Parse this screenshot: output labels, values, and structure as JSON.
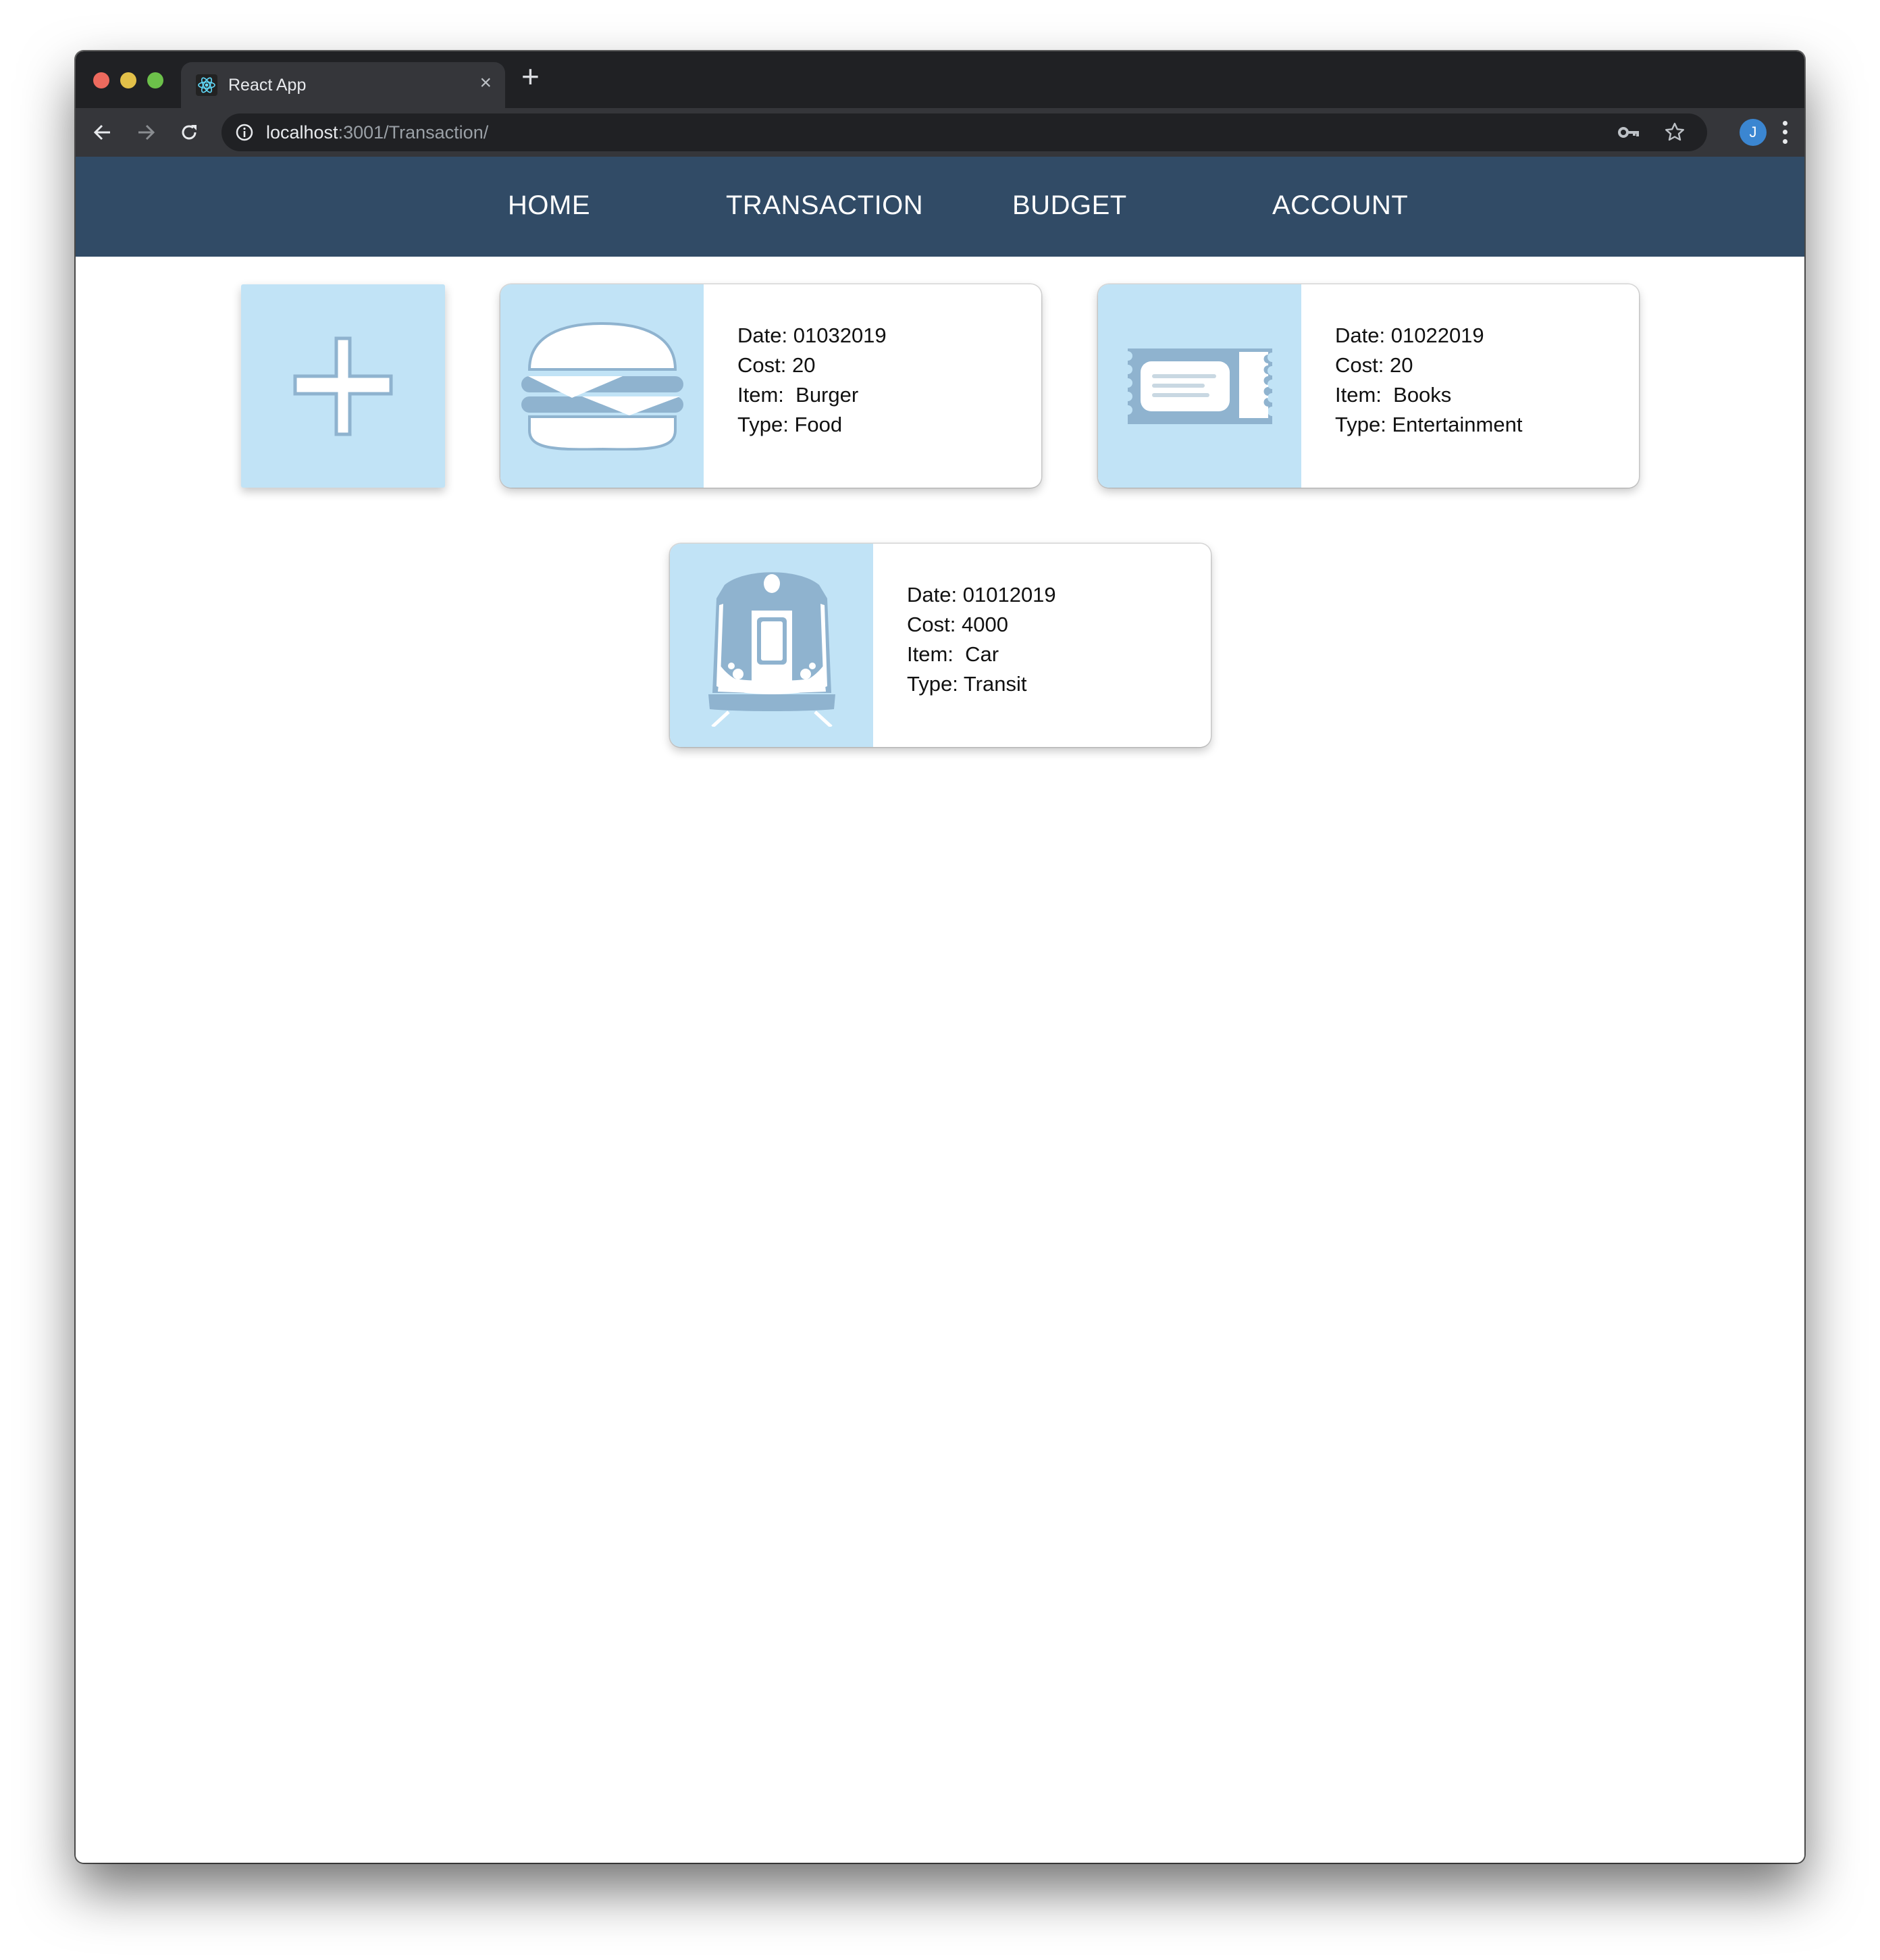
{
  "browser": {
    "tab_title": "React App",
    "new_tab_label": "+",
    "close_tab_label": "×",
    "url_host": "localhost",
    "url_rest": ":3001/Transaction/",
    "avatar_initial": "J"
  },
  "nav": {
    "items": [
      {
        "label": "HOME"
      },
      {
        "label": "TRANSACTION"
      },
      {
        "label": "BUDGET"
      },
      {
        "label": "ACCOUNT"
      }
    ]
  },
  "add_card": {
    "icon": "plus-icon"
  },
  "transactions": [
    {
      "icon": "burger-icon",
      "date_label": "Date:",
      "date": "01032019",
      "cost_label": "Cost:",
      "cost": "20",
      "item_label": "Item:",
      "item": "Burger",
      "type_label": "Type:",
      "type": "Food"
    },
    {
      "icon": "ticket-icon",
      "date_label": "Date:",
      "date": "01022019",
      "cost_label": "Cost:",
      "cost": "20",
      "item_label": "Item:",
      "item": "Books",
      "type_label": "Type:",
      "type": "Entertainment"
    },
    {
      "icon": "train-icon",
      "date_label": "Date:",
      "date": "01012019",
      "cost_label": "Cost:",
      "cost": "4000",
      "item_label": "Item:",
      "item": "Car",
      "type_label": "Type:",
      "type": "Transit"
    }
  ],
  "colors": {
    "nav_bg": "#314b66",
    "icon_panel_bg": "#c1e3f6",
    "icon_fill": "#8fb3cf",
    "avatar_bg": "#3b86d1"
  }
}
